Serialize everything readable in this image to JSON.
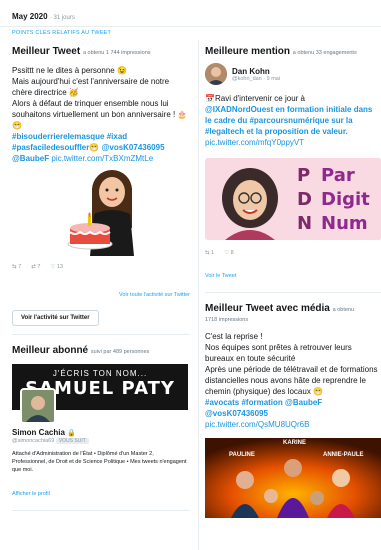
{
  "period": {
    "title": "May 2020",
    "days": "· 31 jours"
  },
  "section_label": "POINTS CLÉS RELATIFS AU TWEET",
  "best_tweet": {
    "title": "Meilleur Tweet",
    "impressions": "a obtenu 1 744 impressions",
    "lines": [
      "Pssittt ne le dites à personne 😉",
      "Mais aujourd'hui c'est l'anniversaire de notre chère directrice 🥳",
      "Alors à défaut de trinquer ensemble nous lui souhaitons virtuellement un bon anniversaire ! 🎂😁"
    ],
    "hashtags": "#bisouderriereIemasque #ixad",
    "hashtags2": "#pasfaciledesouffler😁",
    "mention1": "@vosK07436095",
    "mention2": "@BaubeF",
    "link": "pic.twitter.com/TxBXmZMtLe",
    "stats": {
      "retweets": "7",
      "replies": "7",
      "likes": "13"
    },
    "view_all": "Voir toute l'activité sur Twitter",
    "view_activity_btn": "Voir l'activité sur Twitter"
  },
  "best_follower": {
    "title": "Meilleur abonné",
    "followers": "suivi par 489 personnes",
    "banner_top": "J'ÉCRIS TON NOM...",
    "banner_name": "SAMUEL PATY",
    "name": "Simon Cachia",
    "handle": "@simoncachia69",
    "follows_you": "VOUS SUIT",
    "bio": "Attaché d'Administration de l'État • Diplômé d'un Master 2, Professionnel, de Droit et de Science Politique • Mes tweets n'engagent que moi.",
    "profile_link": "Afficher le profil"
  },
  "best_mention": {
    "title": "Meilleure mention",
    "engagements": "a obtenu 33 engagements",
    "author_name": "Dan Kohn",
    "author_handle": "@kohn_dan · 9 mai",
    "lines": [
      "📅Ravi d'intervenir ce jour à",
      "@IXADNordOuest en formation initiale dans le cadre du #parcoursnumérique sur la #legaltech et la proposition de valeur."
    ],
    "link": "pic.twitter.com/mfqY0ppyVT",
    "media_letters": [
      "P",
      "D",
      "N"
    ],
    "media_words": [
      "Par",
      "Digit",
      "Num"
    ],
    "stats": {
      "retweets": "1",
      "likes": "8"
    },
    "view_tweet": "Voir le Tweet"
  },
  "best_media": {
    "title": "Meilleur Tweet avec média",
    "obtained": "a obtenu",
    "impressions": "1718 impressions",
    "lines": [
      "C'est la reprise !",
      "Nos équipes sont prêtes à retrouver leurs bureaux en toute sécurité",
      "Après une période de télétravail et de formations distancielles nous avons hâte de reprendre le chemin (physique) des locaux 😁"
    ],
    "hashtags": "#avocats #formation",
    "mention1": "@BaubeF",
    "mention2": "@vosK07436095",
    "link": "pic.twitter.com/QsMU8UQr6B",
    "photo_labels": [
      "KARINE",
      "PAULINE",
      "ANNIE-PAULE"
    ]
  }
}
